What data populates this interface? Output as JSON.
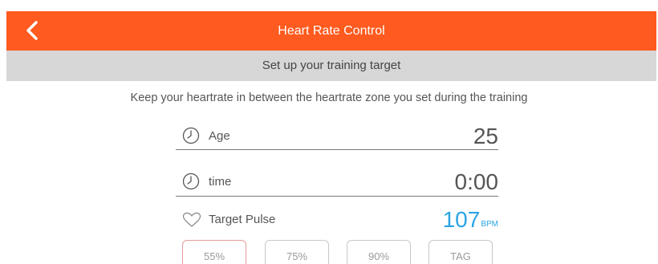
{
  "header": {
    "title": "Heart Rate Control",
    "back_icon": "chevron-left-icon",
    "background": "#ff5a1f"
  },
  "subheader": {
    "text": "Set up your training target",
    "background": "#d7d7d7"
  },
  "intro": "Keep your heartrate in between the heartrate zone you set during the training",
  "fields": {
    "age": {
      "icon": "clock-icon",
      "label": "Age",
      "value": "25"
    },
    "time": {
      "icon": "clock-icon",
      "label": "time",
      "value": "0:00"
    },
    "target_pulse": {
      "icon": "heart-icon",
      "label": "Target Pulse",
      "value": "107",
      "unit": "BPM",
      "value_color": "#2aa4e4"
    }
  },
  "presets": [
    {
      "label": "55%",
      "selected": true
    },
    {
      "label": "75%",
      "selected": false
    },
    {
      "label": "90%",
      "selected": false
    },
    {
      "label": "TAG",
      "selected": false
    }
  ]
}
